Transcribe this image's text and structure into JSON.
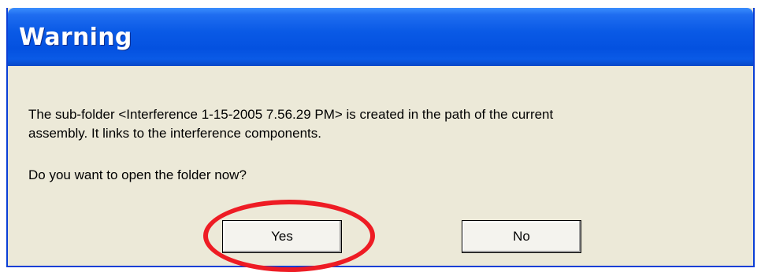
{
  "dialog": {
    "title": "Warning",
    "message_line1": "The sub-folder <Interference 1-15-2005 7.56.29 PM> is created in the path of the current",
    "message_line2": "assembly. It links to the interference components.",
    "question": "Do you want to open the folder now?",
    "yes_label": "Yes",
    "no_label": "No"
  },
  "colors": {
    "titlebar": "#0451e0",
    "dialog_background": "#ece9d8",
    "highlight_ring": "#ee1c24"
  }
}
